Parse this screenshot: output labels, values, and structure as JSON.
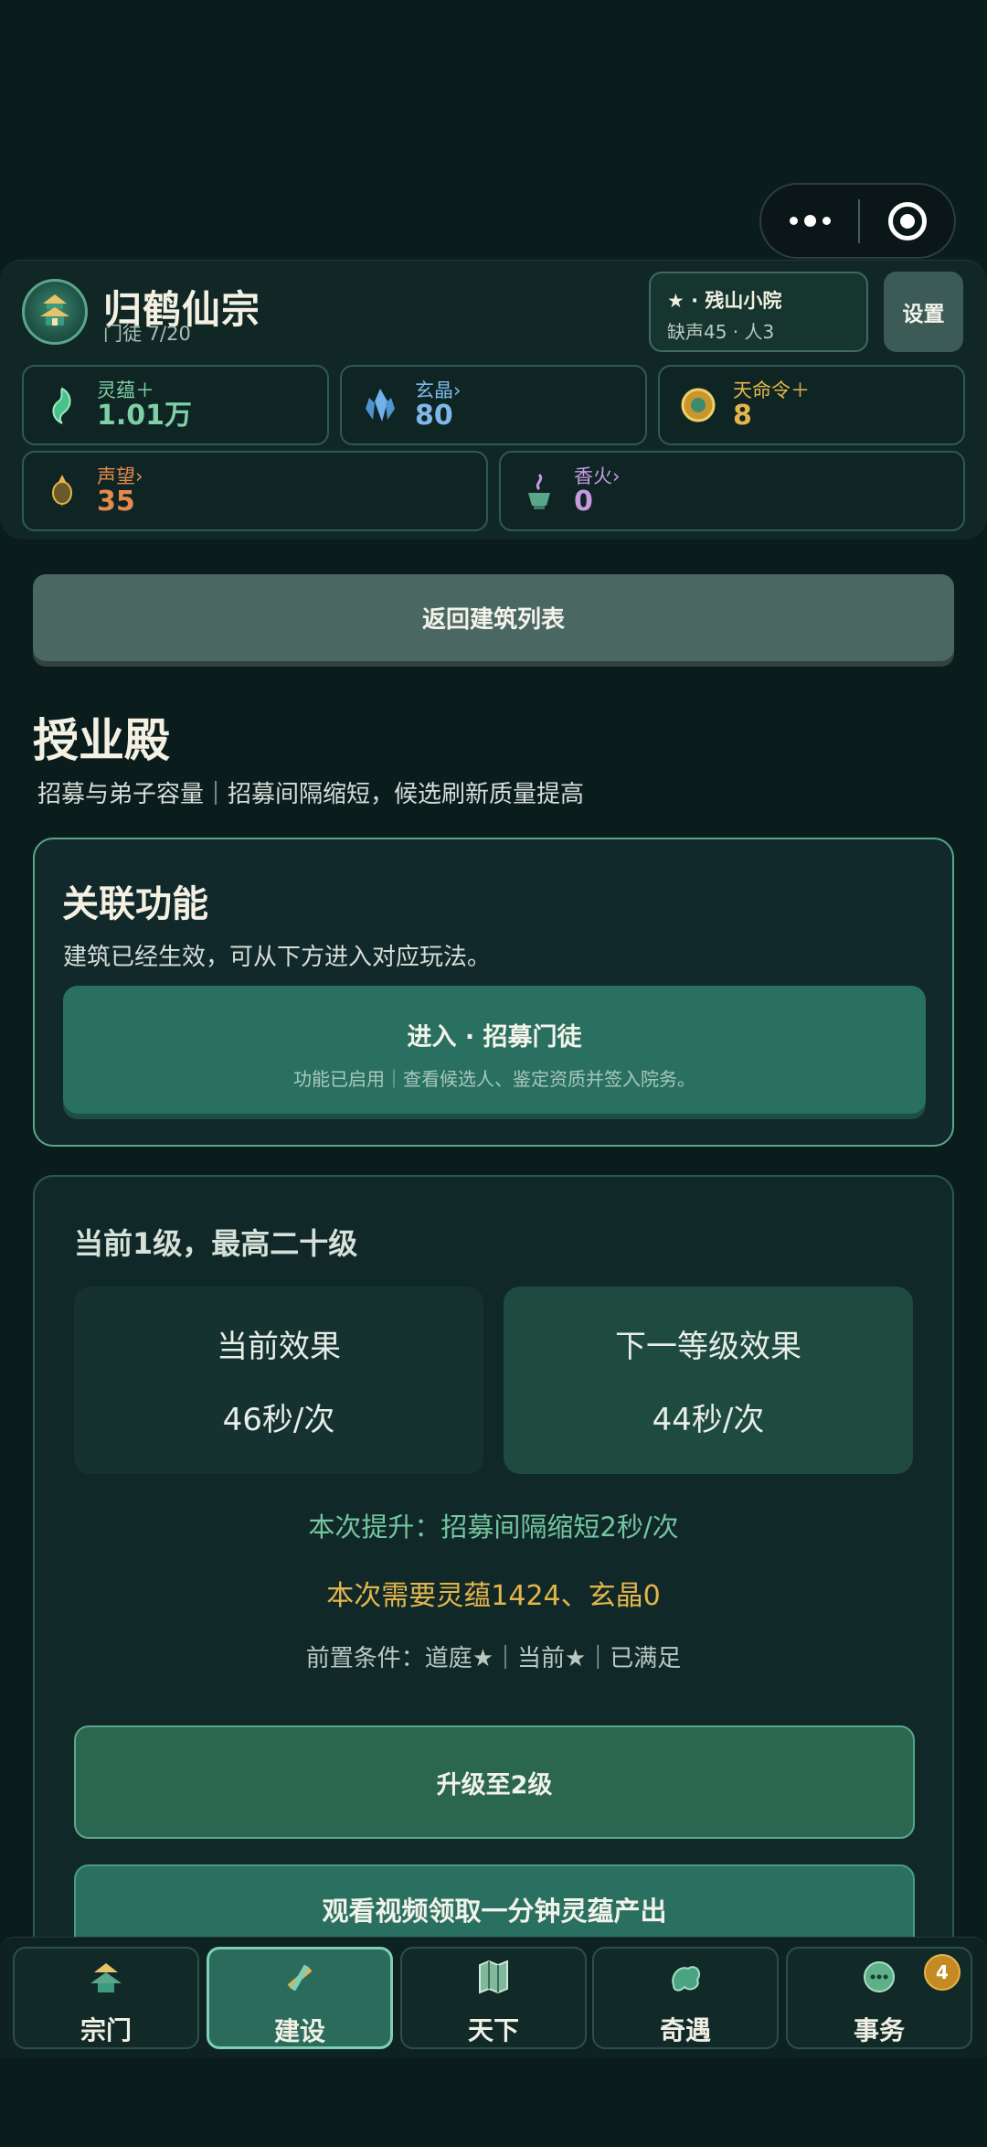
{
  "header": {
    "sect_name": "归鹤仙宗",
    "disciples": "门徒 7/20",
    "status_line1": "★ · 残山小院",
    "status_line2": "缺声45 · 人3",
    "settings_label": "设置"
  },
  "resources": [
    {
      "name": "灵蕴＋",
      "value": "1.01万",
      "color": "#7fd0a6",
      "icon": "spirit-icon"
    },
    {
      "name": "玄晶›",
      "value": "80",
      "color": "#7fb8e8",
      "icon": "crystal-icon"
    },
    {
      "name": "天命令＋",
      "value": "8",
      "color": "#e3b64b",
      "icon": "token-icon"
    },
    {
      "name": "声望›",
      "value": "35",
      "color": "#e58a4e",
      "icon": "prestige-icon"
    },
    {
      "name": "香火›",
      "value": "0",
      "color": "#c79ae0",
      "icon": "incense-icon"
    }
  ],
  "back_label": "返回建筑列表",
  "building": {
    "title": "授业殿",
    "desc": "招募与弟子容量｜招募间隔缩短，候选刷新质量提高"
  },
  "function_card": {
    "title": "关联功能",
    "desc": "建筑已经生效，可从下方进入对应玩法。",
    "enter_title": "进入 · 招募门徒",
    "enter_sub": "功能已启用｜查看候选人、鉴定资质并签入院务。"
  },
  "level_card": {
    "head": "当前1级，最高二十级",
    "current_title": "当前效果",
    "current_value": "46秒/次",
    "next_title": "下一等级效果",
    "next_value": "44秒/次",
    "gain": "本次提升：招募间隔缩短2秒/次",
    "cost": "本次需要灵蕴1424、玄晶0",
    "prereq": "前置条件：道庭★｜当前★｜已满足",
    "upgrade_label": "升级至2级",
    "ad_label": "观看视频领取一分钟灵蕴产出"
  },
  "tabs": [
    {
      "label": "宗门",
      "icon": "sect-icon"
    },
    {
      "label": "建设",
      "icon": "build-icon",
      "active": true
    },
    {
      "label": "天下",
      "icon": "map-icon"
    },
    {
      "label": "奇遇",
      "icon": "encounter-icon"
    },
    {
      "label": "事务",
      "icon": "affairs-icon",
      "badge": "4"
    }
  ]
}
